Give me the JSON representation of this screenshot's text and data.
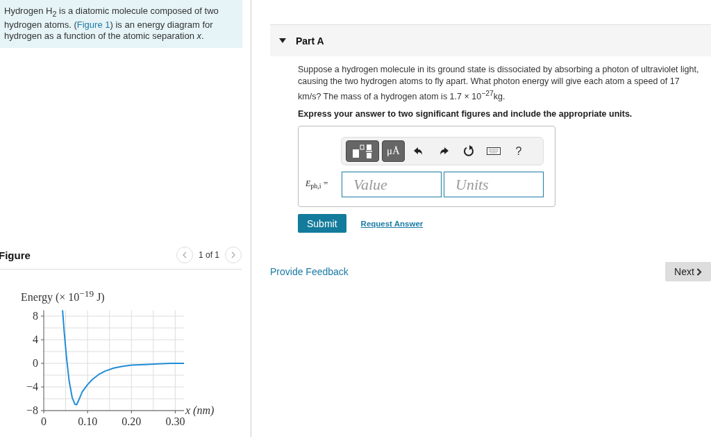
{
  "intro": {
    "before": "Hydrogen H$_{2}$ is a diatomic molecule composed of two hydrogen atoms. (",
    "link": "Figure 1",
    "after": ") is an energy diagram for hydrogen as a function of the atomic separation *x*."
  },
  "figure": {
    "title": "Figure",
    "pager": "1 of 1",
    "chart_data": {
      "type": "line",
      "grid": true,
      "ylabel": "Energy (× 10$^{−19}$ J)",
      "xlabel": "x (nm)",
      "xlim": [
        0,
        0.32
      ],
      "ylim": [
        -8,
        9
      ],
      "xticks": [
        {
          "value": 0,
          "label": "0"
        },
        {
          "value": 0.1,
          "label": "0.10"
        },
        {
          "value": 0.2,
          "label": "0.20"
        },
        {
          "value": 0.3,
          "label": "0.30"
        }
      ],
      "yticks": [
        {
          "value": 8,
          "label": "8"
        },
        {
          "value": 4,
          "label": "4"
        },
        {
          "value": 0,
          "label": "0"
        },
        {
          "value": -4,
          "label": "−4"
        },
        {
          "value": -8,
          "label": "−8"
        }
      ],
      "x": [
        0.043,
        0.047,
        0.052,
        0.058,
        0.065,
        0.071,
        0.075,
        0.08,
        0.088,
        0.1,
        0.11,
        0.125,
        0.14,
        0.16,
        0.18,
        0.2,
        0.23,
        0.26,
        0.29,
        0.32
      ],
      "series": [
        {
          "color": "#1f8dd6",
          "values": [
            9,
            5,
            1,
            -3,
            -5.8,
            -6.9,
            -7,
            -6.2,
            -4.8,
            -3.6,
            -2.8,
            -1.9,
            -1.3,
            -0.8,
            -0.5,
            -0.3,
            -0.2,
            -0.1,
            0,
            0
          ]
        }
      ]
    }
  },
  "part": {
    "title": "Part A",
    "expanded": true,
    "question": "Suppose a hydrogen molecule in its ground state is dissociated by absorbing a photon of ultraviolet light, causing the two hydrogen atoms to fly apart. What photon energy will give each atom a speed of 17 km/s? The mass of a hydrogen atom is 1.7 × 10$^{−27}$kg.",
    "instruction": "Express your answer to two significant figures and include the appropriate units.",
    "toolbar": [
      {
        "kind": "templates"
      },
      {
        "kind": "units",
        "label": "μÅ"
      },
      {
        "kind": "undo"
      },
      {
        "kind": "redo"
      },
      {
        "kind": "reset"
      },
      {
        "kind": "keyboard"
      },
      {
        "kind": "help",
        "label": "?"
      }
    ],
    "answer_label": "*E*$_{ph,i}$ =",
    "value": {
      "placeholder": "Value"
    },
    "units": {
      "placeholder": "Units"
    },
    "submit": "Submit",
    "request": "Request Answer"
  },
  "feedback": "Provide Feedback",
  "next": "Next"
}
